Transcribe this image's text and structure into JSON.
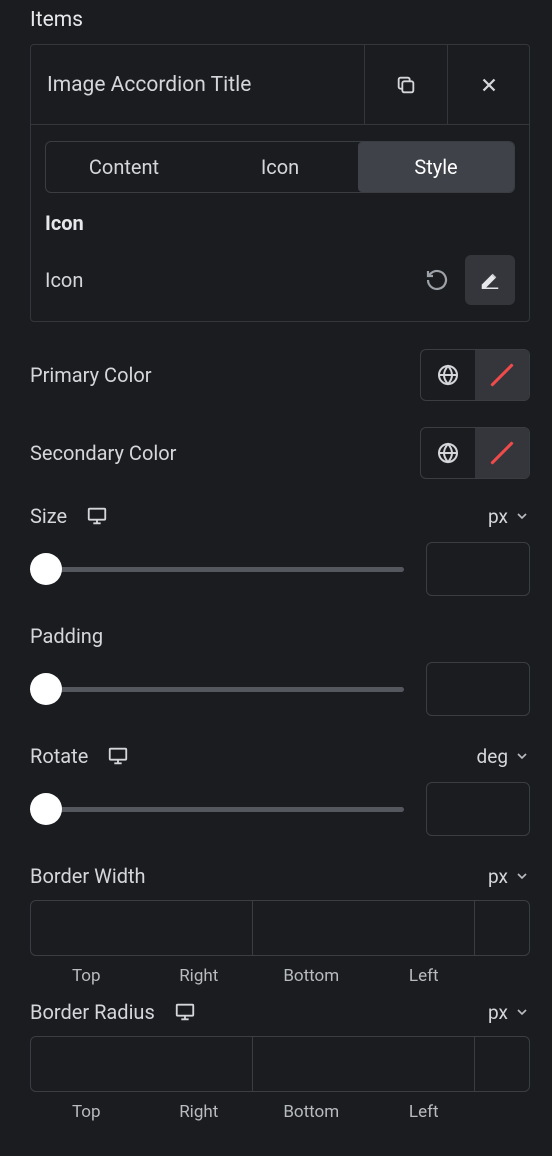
{
  "section": {
    "title": "Items"
  },
  "item": {
    "title": "Image Accordion Title",
    "tabs": {
      "content": "Content",
      "icon": "Icon",
      "style": "Style",
      "active": "style"
    },
    "group_label": "Icon",
    "icon_row_label": "Icon"
  },
  "popover": {
    "primary_color_label": "Primary Color",
    "secondary_color_label": "Secondary Color",
    "size_label": "Size",
    "size_unit": "px",
    "size_value": "",
    "padding_label": "Padding",
    "padding_value": "",
    "rotate_label": "Rotate",
    "rotate_unit": "deg",
    "rotate_value": "",
    "border_width_label": "Border Width",
    "border_width_unit": "px",
    "border_width": {
      "top": "",
      "right": "",
      "bottom": "",
      "left": ""
    },
    "border_radius_label": "Border Radius",
    "border_radius_unit": "px",
    "border_radius": {
      "top": "",
      "right": "",
      "bottom": "",
      "left": ""
    },
    "side_labels": {
      "top": "Top",
      "right": "Right",
      "bottom": "Bottom",
      "left": "Left"
    }
  }
}
